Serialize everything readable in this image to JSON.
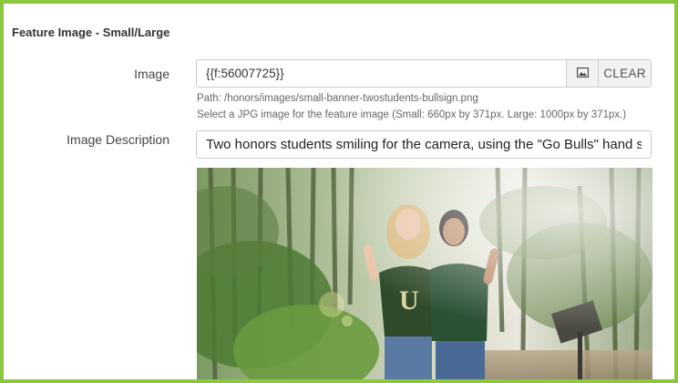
{
  "panel": {
    "title": "Feature Image - Small/Large"
  },
  "image_field": {
    "label": "Image",
    "value": "{{f:56007725}}",
    "picker_icon": "image-icon",
    "clear_label": "CLEAR",
    "path_text": "Path: /honors/images/small-banner-twostudents-bullsign.png",
    "help_text": "Select a JPG image for the feature image (Small: 660px by 371px. Large: 1000px by 371px.)"
  },
  "description_field": {
    "label": "Image Description",
    "value": "Two honors students smiling for the camera, using the \"Go Bulls\" hand symbol"
  },
  "colors": {
    "frame_border": "#8dc63f",
    "addon_bg": "#f2f2f2",
    "input_border": "#cccccc"
  }
}
